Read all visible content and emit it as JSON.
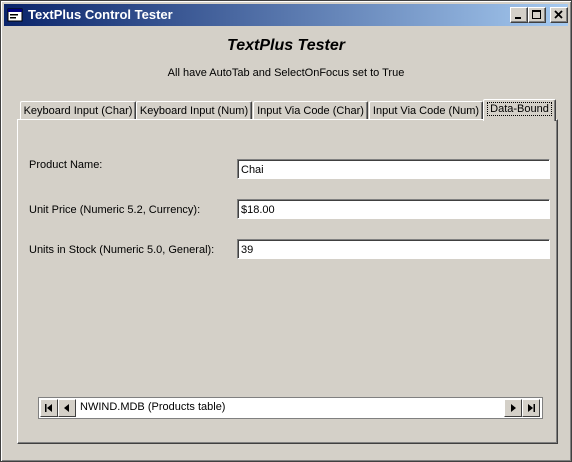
{
  "window": {
    "title": "TextPlus Control Tester"
  },
  "header": {
    "title": "TextPlus Tester",
    "subtitle": "All have AutoTab and SelectOnFocus set to True"
  },
  "tabs": [
    {
      "label": "Keyboard Input (Char)"
    },
    {
      "label": "Keyboard Input (Num)"
    },
    {
      "label": "Input Via Code (Char)"
    },
    {
      "label": "Input Via Code (Num)"
    },
    {
      "label": "Data-Bound",
      "active": true
    }
  ],
  "form": {
    "product_name": {
      "label": "Product Name:",
      "value": "Chai"
    },
    "unit_price": {
      "label": "Unit Price (Numeric 5.2, Currency):",
      "value": "$18.00"
    },
    "units_in_stock": {
      "label": "Units in Stock (Numeric 5.0, General):",
      "value": "39"
    }
  },
  "data_control": {
    "caption": "NWIND.MDB (Products table)"
  },
  "colors": {
    "titlebar_start": "#0a246a",
    "titlebar_end": "#a6caf0",
    "face": "#d4d0c8"
  }
}
